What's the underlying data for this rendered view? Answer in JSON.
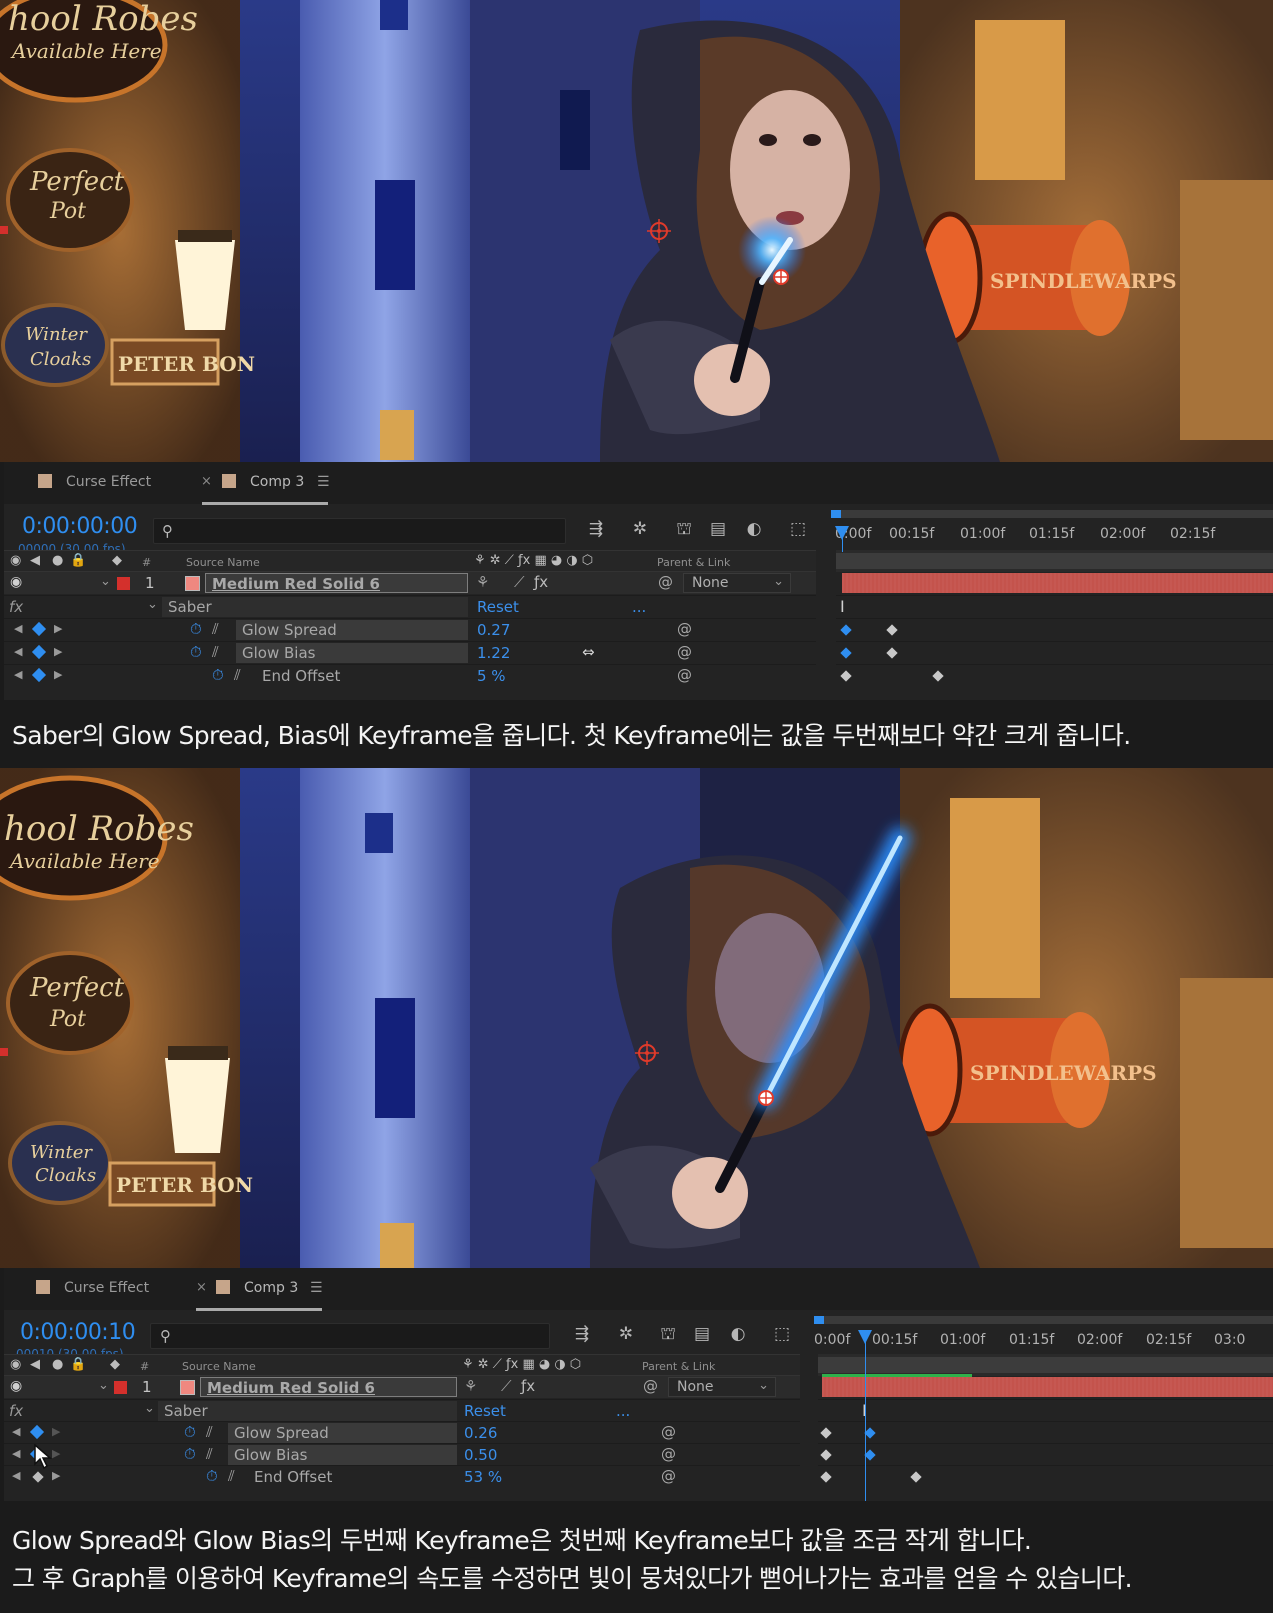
{
  "panels": [
    {
      "tabs": [
        {
          "label": "Curse Effect"
        },
        {
          "label": "Comp 3"
        }
      ],
      "timecode": "0:00:00:00",
      "fps": "00000 (30.00 fps)",
      "ruler_ticks": [
        "0:00f",
        "00:15f",
        "01:00f",
        "01:15f",
        "02:00f",
        "02:15f"
      ],
      "columns": {
        "source_name": "Source Name",
        "parent_link": "Parent & Link"
      },
      "layer": {
        "number": "1",
        "name": "Medium Red Solid 6",
        "parent": "None"
      },
      "effect": {
        "name": "Saber",
        "reset": "Reset",
        "dots": "..."
      },
      "properties": [
        {
          "name": "Glow Spread",
          "value": "0.27"
        },
        {
          "name": "Glow Bias",
          "value": "1.22"
        },
        {
          "name": "End Offset",
          "value": "5 %"
        }
      ]
    },
    {
      "tabs": [
        {
          "label": "Curse Effect"
        },
        {
          "label": "Comp 3"
        }
      ],
      "timecode": "0:00:00:10",
      "fps": "00010 (30.00 fps)",
      "ruler_ticks": [
        "0:00f",
        "00:15f",
        "01:00f",
        "01:15f",
        "02:00f",
        "02:15f",
        "03:0"
      ],
      "columns": {
        "source_name": "Source Name",
        "parent_link": "Parent & Link"
      },
      "layer": {
        "number": "1",
        "name": "Medium Red Solid 6",
        "parent": "None"
      },
      "effect": {
        "name": "Saber",
        "reset": "Reset",
        "dots": "..."
      },
      "properties": [
        {
          "name": "Glow Spread",
          "value": "0.26"
        },
        {
          "name": "Glow Bias",
          "value": "0.50"
        },
        {
          "name": "End Offset",
          "value": "53 %"
        }
      ]
    }
  ],
  "scene": {
    "sign_text_1": "hool Robes",
    "sign_text_2": "Available Here",
    "sign_text_3": "Perfect",
    "sign_text_4": "Pot",
    "sign_text_5": "Winter",
    "sign_text_6": "Cloaks",
    "sign_text_7": "PETER BON",
    "sign_text_8": "SPINDLEWARPS"
  },
  "captions": {
    "caption_1": "Saber의 Glow Spread, Bias에 Keyframe을 줍니다. 첫 Keyframe에는 값을 두번째보다 약간 크게 줍니다.",
    "caption_2_line_1": "Glow Spread와 Glow Bias의 두번째 Keyframe은 첫번째 Keyframe보다 값을 조금 작게 합니다.",
    "caption_2_line_2": "그 후 Graph를 이용하여 Keyframe의 속도를 수정하면 빛이 뭉쳐있다가 뻗어나가는 효과를 얻을 수 있습니다."
  },
  "colors": {
    "accent_blue": "#2f8ef0",
    "layer_label_red": "#d4302c",
    "layer_bar_red": "#c4534c",
    "saber_glow": "#3da9ff"
  }
}
